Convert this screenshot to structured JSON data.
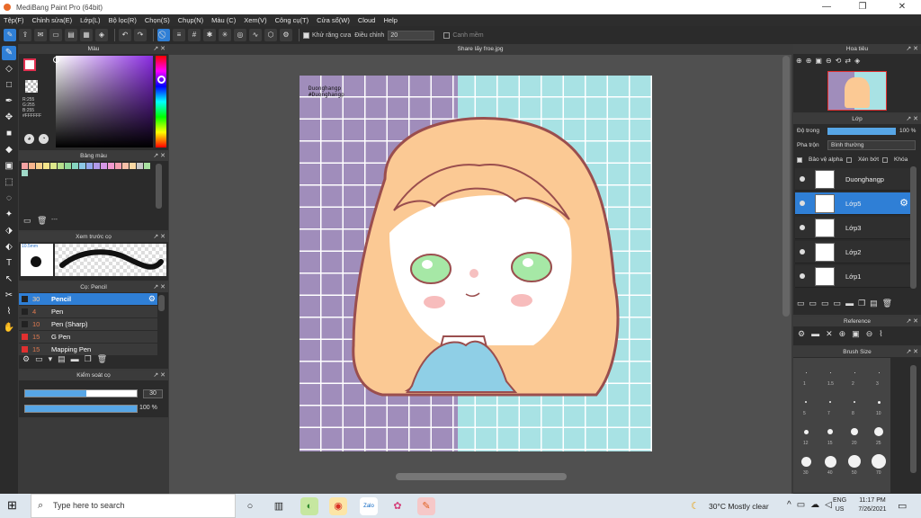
{
  "window": {
    "title": "MediBang Paint Pro (64bit)",
    "controls": [
      "—",
      "❐",
      "✕"
    ]
  },
  "menu": [
    "Tệp(F)",
    "Chỉnh sửa(E)",
    "Lớp(L)",
    "Bộ lọc(R)",
    "Chọn(S)",
    "Chụp(N)",
    "Màu (C)",
    "Xem(V)",
    "Công cụ(T)",
    "Cửa sổ(W)",
    "Cloud",
    "Help"
  ],
  "toolbar": {
    "antialias_label": "Khử răng cưa",
    "adjust_label": "Điều chỉnh",
    "adjust_value": "20",
    "snap_label": "Canh mềm"
  },
  "color_panel": {
    "title": "Màu",
    "rgb": [
      "R:255",
      "G:255",
      "B:255"
    ],
    "hex": "#FFFFFF"
  },
  "palette_panel": {
    "title": "Bảng màu",
    "dash": "---",
    "swatches": [
      "#f5a3a3",
      "#f7b58d",
      "#f7cf8a",
      "#f5e58a",
      "#dde88b",
      "#b7e08c",
      "#8fd99a",
      "#86d6c1",
      "#8cc8e6",
      "#94a8ee",
      "#b19aea",
      "#d597e6",
      "#f29ad0",
      "#f5a0b0",
      "#f7c0a8",
      "#f9d8a4",
      "#c8c8c8",
      "#a8e0a0",
      "#a0d9c8"
    ]
  },
  "brush_preview": {
    "title": "Xem trước cọ",
    "size": "10.5mm"
  },
  "brush_panel": {
    "title": "Cọ: Pencil",
    "items": [
      {
        "size": "30",
        "name": "Pencil",
        "color": "#222222",
        "selected": true
      },
      {
        "size": "4",
        "name": "Pen",
        "color": "#222222",
        "selected": false
      },
      {
        "size": "10",
        "name": "Pen (Sharp)",
        "color": "#222222",
        "selected": false
      },
      {
        "size": "15",
        "name": "G Pen",
        "color": "#e03030",
        "selected": false
      },
      {
        "size": "15",
        "name": "Mapping Pen",
        "color": "#e03030",
        "selected": false
      }
    ]
  },
  "brush_control": {
    "title": "Kiểm soát cọ",
    "size_value": "30",
    "size_fraction": 0.55,
    "opacity_value": "100 %",
    "opacity_fraction": 1.0
  },
  "document": {
    "tab": "Share lấy froe.jpg",
    "signature": "Duonghangp\n#Duonghangp"
  },
  "navigator": {
    "title": "Hoa tiêu"
  },
  "layer_panel": {
    "title": "Lớp",
    "opacity_label": "Độ trong",
    "opacity_value": "100 %",
    "blend_label": "Pha trộn",
    "blend_value": "Bình thường",
    "protect_alpha": "Bảo vệ alpha",
    "clipping": "Xén bớt",
    "lock": "Khóa",
    "layers": [
      {
        "name": "Duonghangp",
        "selected": false
      },
      {
        "name": "Lớp5",
        "selected": true
      },
      {
        "name": "Lớp3",
        "selected": false
      },
      {
        "name": "Lớp2",
        "selected": false
      },
      {
        "name": "Lớp1",
        "selected": false
      }
    ]
  },
  "reference_panel": {
    "title": "Reference"
  },
  "brush_size_panel": {
    "title": "Brush Size",
    "labels": [
      "1",
      "1.5",
      "2",
      "3",
      "5",
      "7",
      "8",
      "10",
      "12",
      "15",
      "20",
      "25",
      "30",
      "40",
      "50",
      "70"
    ]
  },
  "taskbar": {
    "search_placeholder": "Type here to search",
    "weather": "30°C  Mostly clear",
    "lang": "ENG",
    "region": "US",
    "time": "11:17 PM",
    "date": "7/26/2021"
  }
}
